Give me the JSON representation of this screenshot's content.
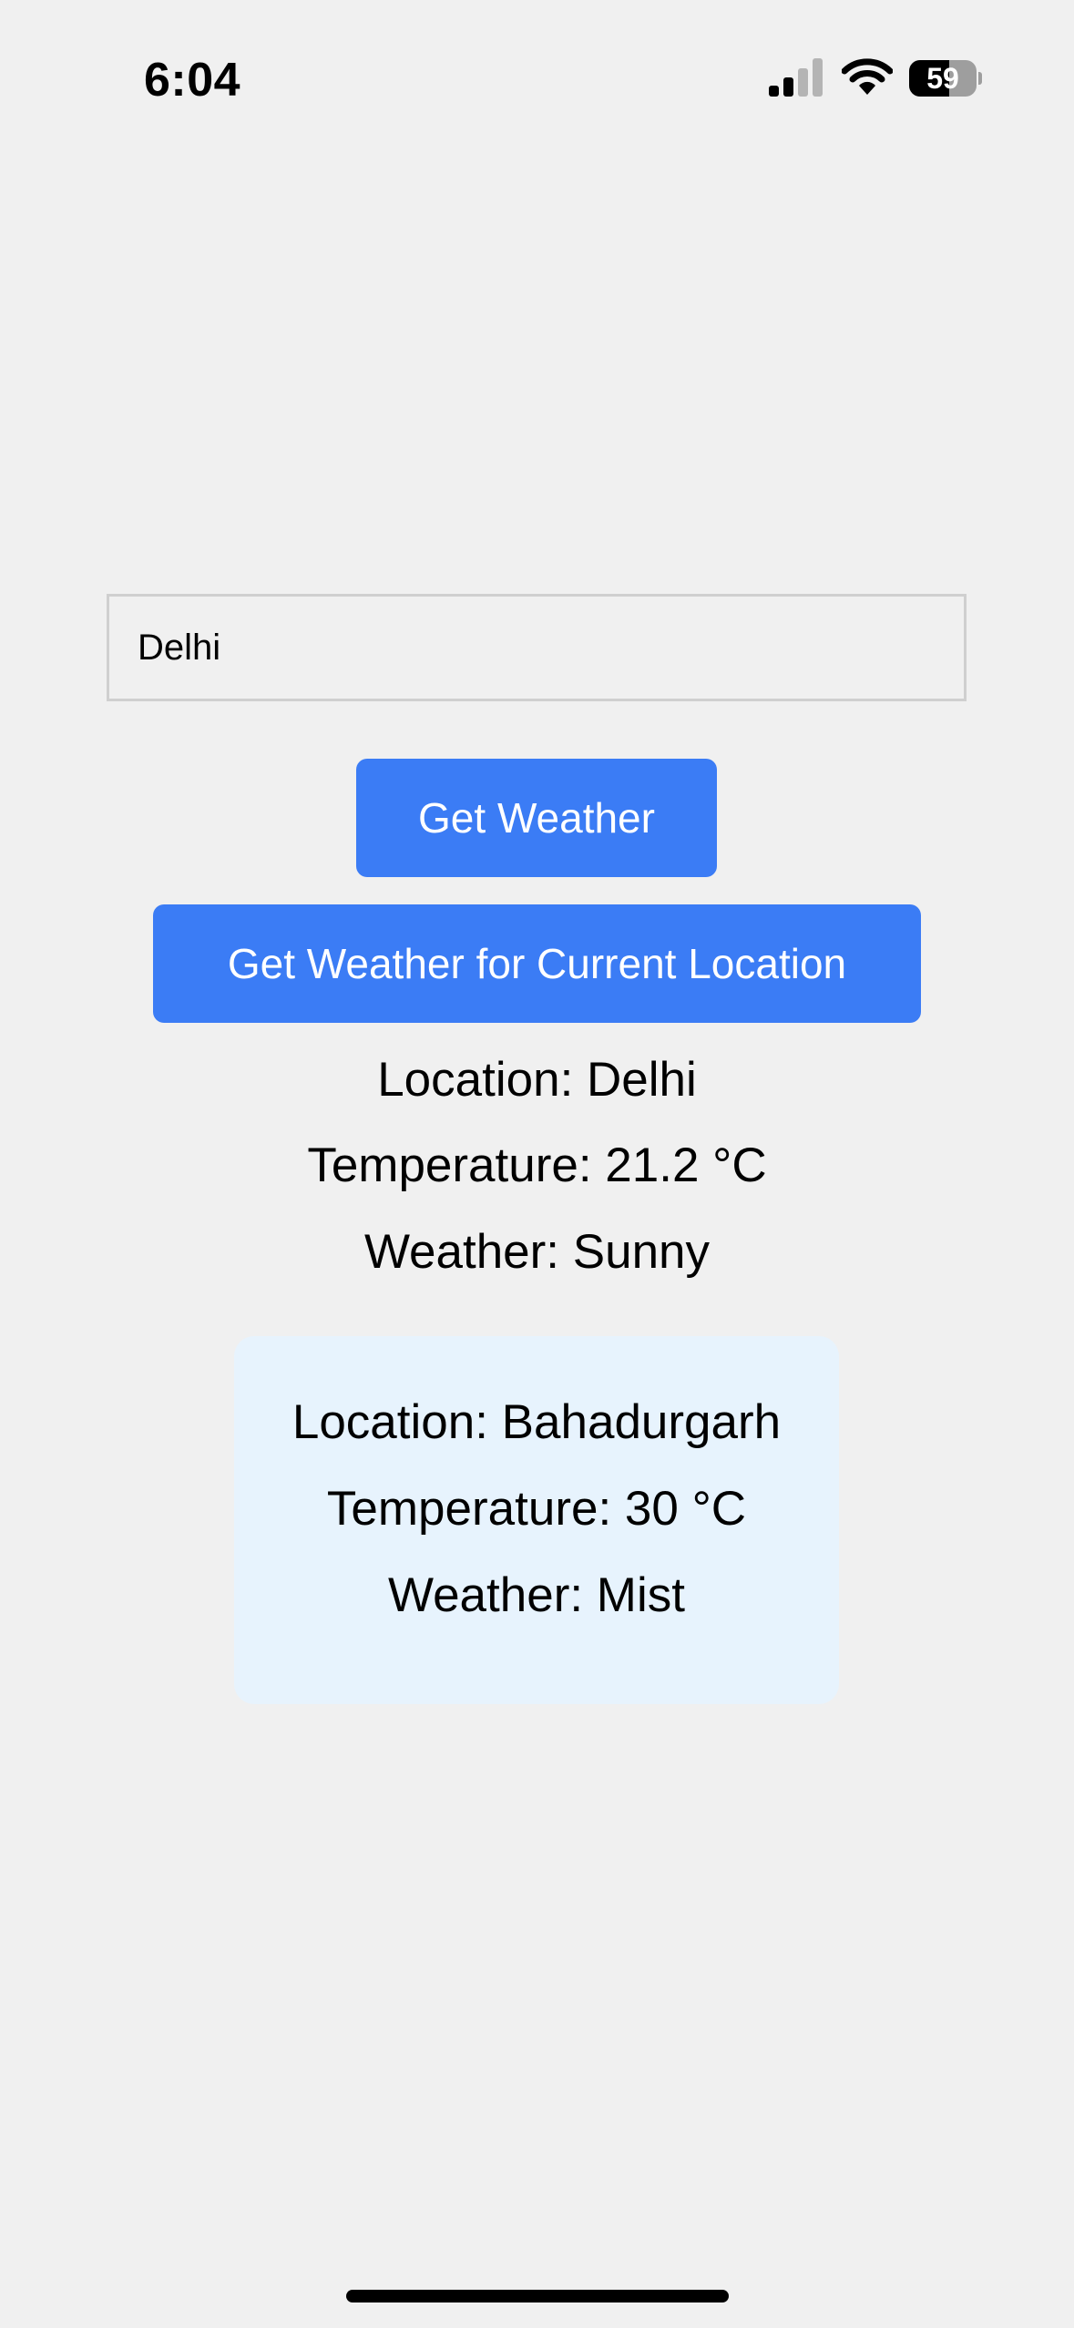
{
  "status_bar": {
    "time": "6:04",
    "signal_icon": "cellular-signal-icon",
    "signal_bars_active": 2,
    "signal_bars_total": 4,
    "wifi_icon": "wifi-icon",
    "battery_icon": "battery-icon",
    "battery_level": "59",
    "battery_fraction": 0.59
  },
  "search": {
    "value": "Delhi",
    "placeholder": ""
  },
  "buttons": {
    "get_weather": "Get Weather",
    "current_location": "Get Weather for Current Location"
  },
  "result": {
    "location": "Location: Delhi",
    "temperature": "Temperature: 21.2 °C",
    "weather": "Weather: Sunny"
  },
  "current_location_card": {
    "location": "Location: Bahadurgarh",
    "temperature": "Temperature: 30 °C",
    "weather": "Weather: Mist"
  },
  "colors": {
    "background": "#f0f0f0",
    "button": "#3b7cf5",
    "button_text": "#ffffff",
    "card_background": "#e7f3fd",
    "input_border": "#cfcfcf"
  }
}
